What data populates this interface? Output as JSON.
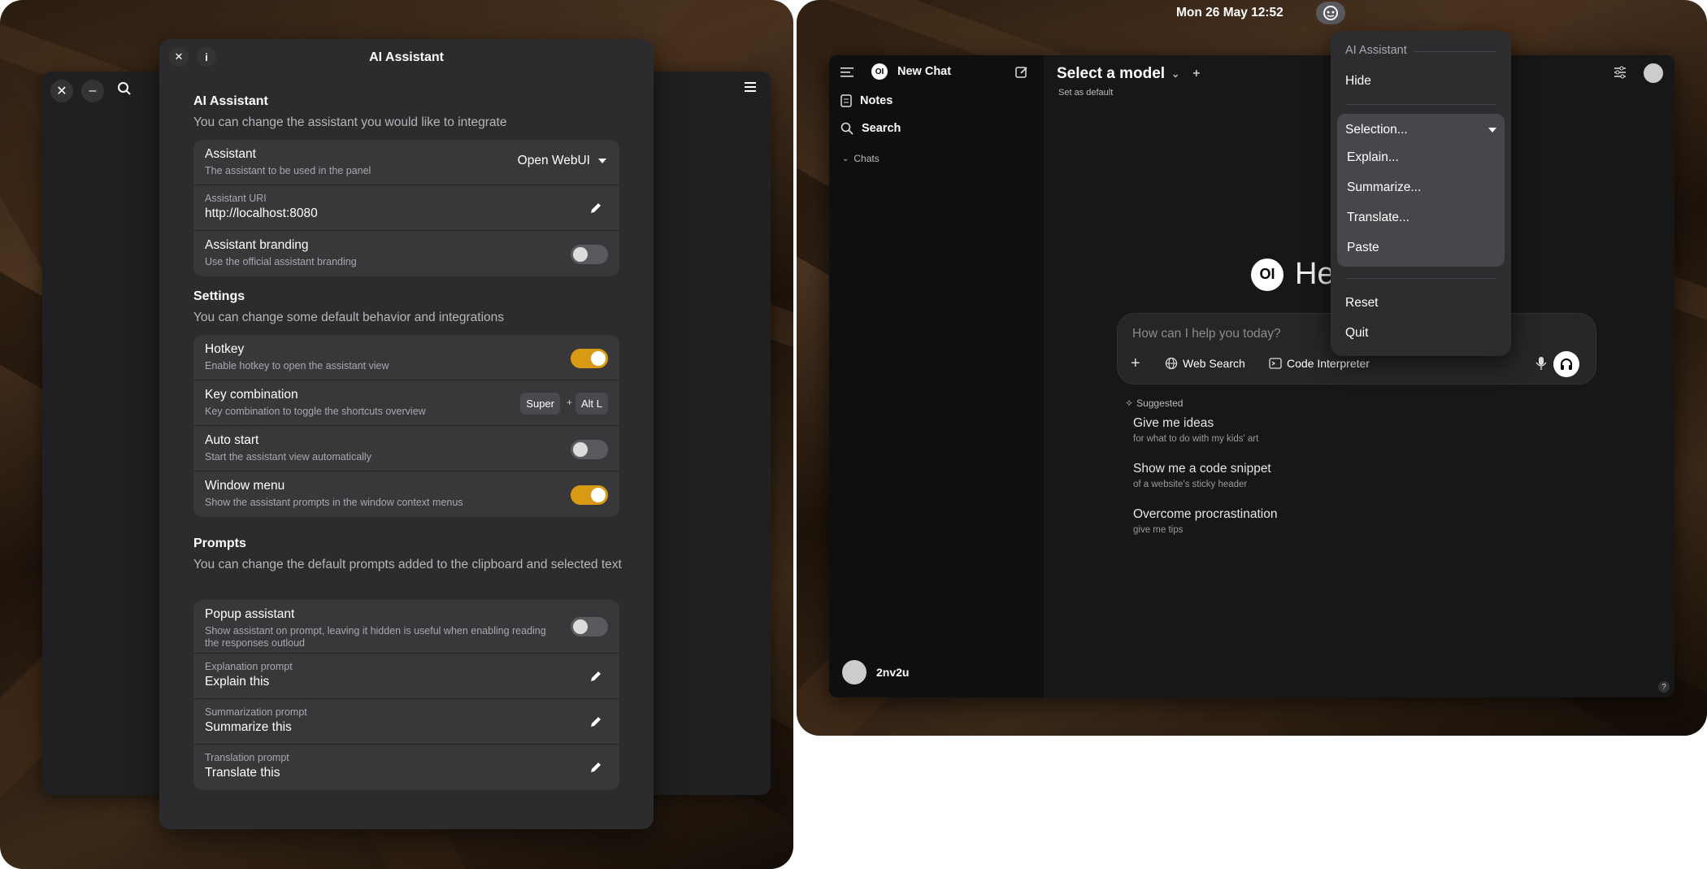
{
  "left_window": {
    "dialog": {
      "title": "AI Assistant",
      "sections": {
        "assistant": {
          "title": "AI Assistant",
          "desc": "You can change the assistant you would like to integrate",
          "rows": {
            "assistant": {
              "title": "Assistant",
              "sub": "The assistant to be used in the panel",
              "value": "Open WebUI"
            },
            "uri": {
              "label": "Assistant URI",
              "value": "http://localhost:8080"
            },
            "branding": {
              "title": "Assistant branding",
              "sub": "Use the official assistant branding",
              "on": false
            }
          }
        },
        "settings": {
          "title": "Settings",
          "desc": "You can change some default behavior and integrations",
          "rows": {
            "hotkey": {
              "title": "Hotkey",
              "sub": "Enable hotkey to open the assistant view",
              "on": true
            },
            "keycomb": {
              "title": "Key combination",
              "sub": "Key combination to toggle the shortcuts overview",
              "key1": "Super",
              "plus": "+",
              "key2": "Alt L"
            },
            "autostart": {
              "title": "Auto start",
              "sub": "Start the assistant view automatically",
              "on": false
            },
            "windowmenu": {
              "title": "Window menu",
              "sub": "Show the assistant prompts in the window context menus",
              "on": true
            }
          }
        },
        "prompts": {
          "title": "Prompts",
          "desc": "You can change the default prompts added to the clipboard and selected text",
          "rows": {
            "popup": {
              "title": "Popup assistant",
              "sub": "Show assistant on prompt, leaving it hidden is useful when enabling reading the responses outloud",
              "on": false
            },
            "explanation": {
              "label": "Explanation prompt",
              "value": "Explain this"
            },
            "summarization": {
              "label": "Summarization prompt",
              "value": "Summarize this"
            },
            "translation": {
              "label": "Translation prompt",
              "value": "Translate this"
            }
          }
        }
      }
    }
  },
  "right_screen": {
    "topbar": {
      "datetime": "Mon 26 May  12:52"
    },
    "sidebar": {
      "new_chat": "New Chat",
      "notes": "Notes",
      "search": "Search",
      "chats": "Chats",
      "user": "2nv2u"
    },
    "header": {
      "model": "Select a model",
      "set_default": "Set as default"
    },
    "greeting": "He",
    "composer": {
      "placeholder": "How can I help you today?",
      "web_search": "Web Search",
      "code_interpreter": "Code Interpreter"
    },
    "suggested": {
      "label": "Suggested",
      "items": [
        {
          "title": "Give me ideas",
          "sub": "for what to do with my kids' art"
        },
        {
          "title": "Show me a code snippet",
          "sub": "of a website's sticky header"
        },
        {
          "title": "Overcome procrastination",
          "sub": "give me tips"
        }
      ]
    },
    "help": "?",
    "menu": {
      "header": "AI Assistant",
      "hide": "Hide",
      "selection": "Selection...",
      "explain": "Explain...",
      "summarize": "Summarize...",
      "translate": "Translate...",
      "paste": "Paste",
      "reset": "Reset",
      "quit": "Quit"
    }
  },
  "colors": {
    "accent": "#d89a12",
    "panel": "#2c2c2f",
    "row": "#38383b"
  }
}
